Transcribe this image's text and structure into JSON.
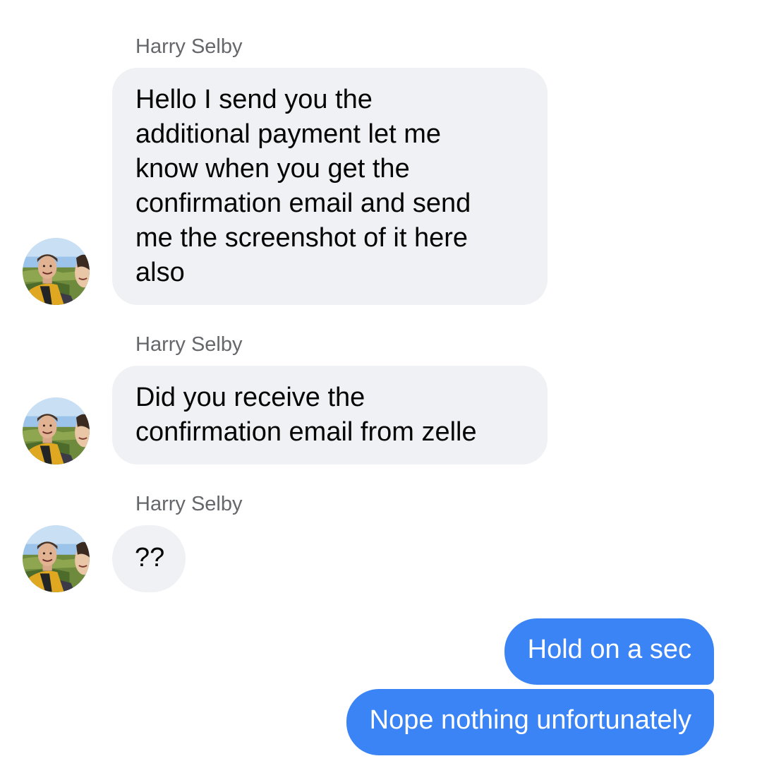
{
  "conversation": {
    "messages": [
      {
        "sender": "Harry Selby",
        "text": "Hello I send you the\nadditional payment let me\nknow when you get the\nconfirmation email and send\nme the screenshot of it here\nalso"
      },
      {
        "sender": "Harry Selby",
        "text": "Did you receive the\nconfirmation email from zelle"
      },
      {
        "sender": "Harry Selby",
        "text": "??"
      }
    ],
    "replies": [
      {
        "text": "Hold on a sec"
      },
      {
        "text": "Nope nothing unfortunately"
      }
    ]
  },
  "colors": {
    "incoming_bubble": "#f0f1f4",
    "outgoing_bubble": "#3b84f5",
    "sender_name": "#65676b"
  },
  "icons": {
    "avatar": "contact-avatar-photo"
  }
}
